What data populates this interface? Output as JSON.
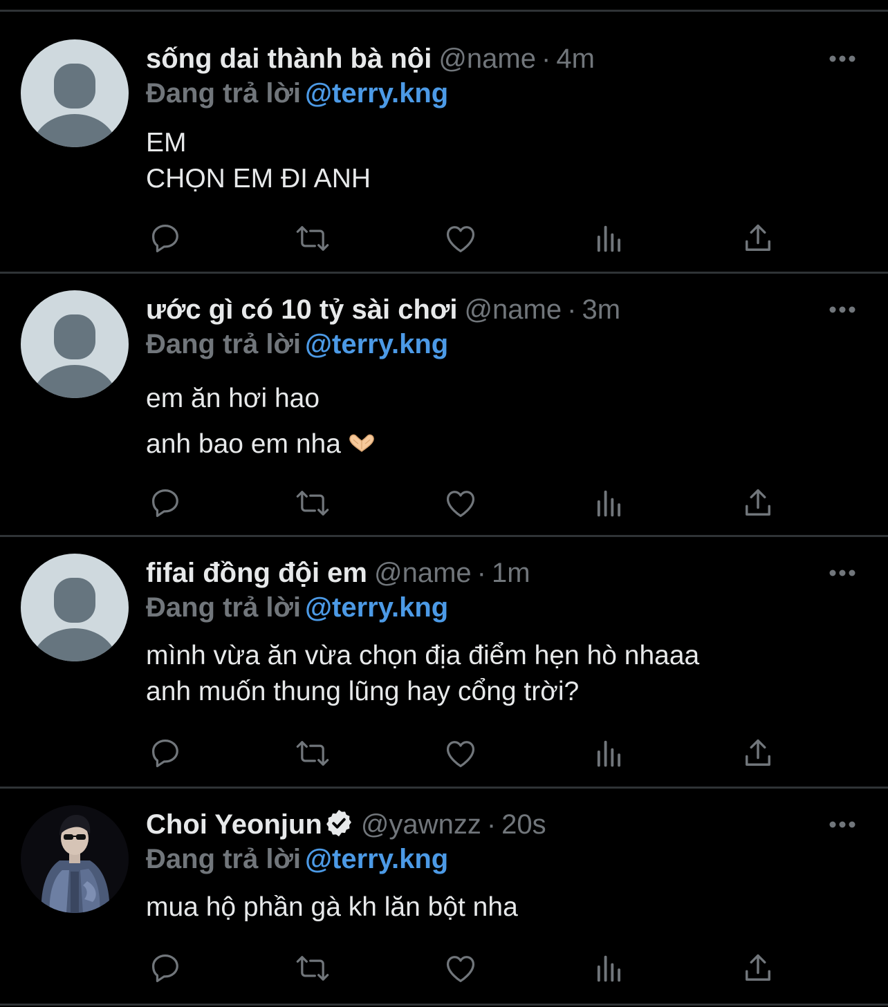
{
  "reply_prefix": "Đang trả lời",
  "tweets": [
    {
      "display_name": "sống dai thành bà nội",
      "handle": "@name",
      "separator": "·",
      "time": "4m",
      "reply_to": "@terry.kng",
      "lines": [
        "EM",
        "CHỌN EM ĐI ANH"
      ],
      "avatar": "default-avatar",
      "verified": false
    },
    {
      "display_name": "ước gì có 10 tỷ sài chơi",
      "handle": "@name",
      "separator": "·",
      "time": "3m",
      "reply_to": "@terry.kng",
      "lines": [
        "em ăn hơi hao",
        "anh bao em nha"
      ],
      "avatar": "default-avatar",
      "verified": false,
      "emoji": "heart-hands-emoji"
    },
    {
      "display_name": "fifai đồng đội em",
      "handle": "@name",
      "separator": "·",
      "time": "1m",
      "reply_to": "@terry.kng",
      "lines": [
        "mình vừa ăn vừa chọn địa điểm hẹn hò nhaaa",
        "anh muốn thung lũng hay cổng trời?"
      ],
      "avatar": "default-avatar",
      "verified": false
    },
    {
      "display_name": "Choi Yeonjun",
      "handle": "@yawnzz",
      "separator": "·",
      "time": "20s",
      "reply_to": "@terry.kng",
      "lines": [
        "mua hộ phần gà kh lăn bột nha"
      ],
      "avatar": "photo-avatar",
      "verified": true
    }
  ],
  "action_icons": [
    "reply-icon",
    "retweet-icon",
    "like-icon",
    "views-icon",
    "share-icon"
  ],
  "colors": {
    "background": "#000000",
    "text": "#e7e9ea",
    "muted": "#71767b",
    "link": "#4c9ae6",
    "divider": "#2f3336",
    "avatar_bg": "#cfd9de",
    "avatar_silhouette": "#66757f"
  }
}
